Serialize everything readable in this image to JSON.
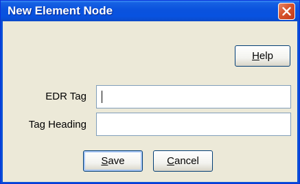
{
  "window": {
    "title": "New Element Node"
  },
  "toolbar": {
    "help_label": "Help",
    "help_mnemonic": "H",
    "help_rest": "elp"
  },
  "form": {
    "edr_tag": {
      "label": "EDR Tag",
      "value": ""
    },
    "tag_heading": {
      "label": "Tag Heading",
      "value": ""
    }
  },
  "actions": {
    "save_label": "Save",
    "save_mnemonic": "S",
    "save_rest": "ave",
    "cancel_label": "Cancel",
    "cancel_mnemonic": "C",
    "cancel_rest": "ancel"
  },
  "colors": {
    "titlebar": "#0a52dd",
    "client_background": "#ece9d8",
    "close_button": "#d6532c"
  }
}
